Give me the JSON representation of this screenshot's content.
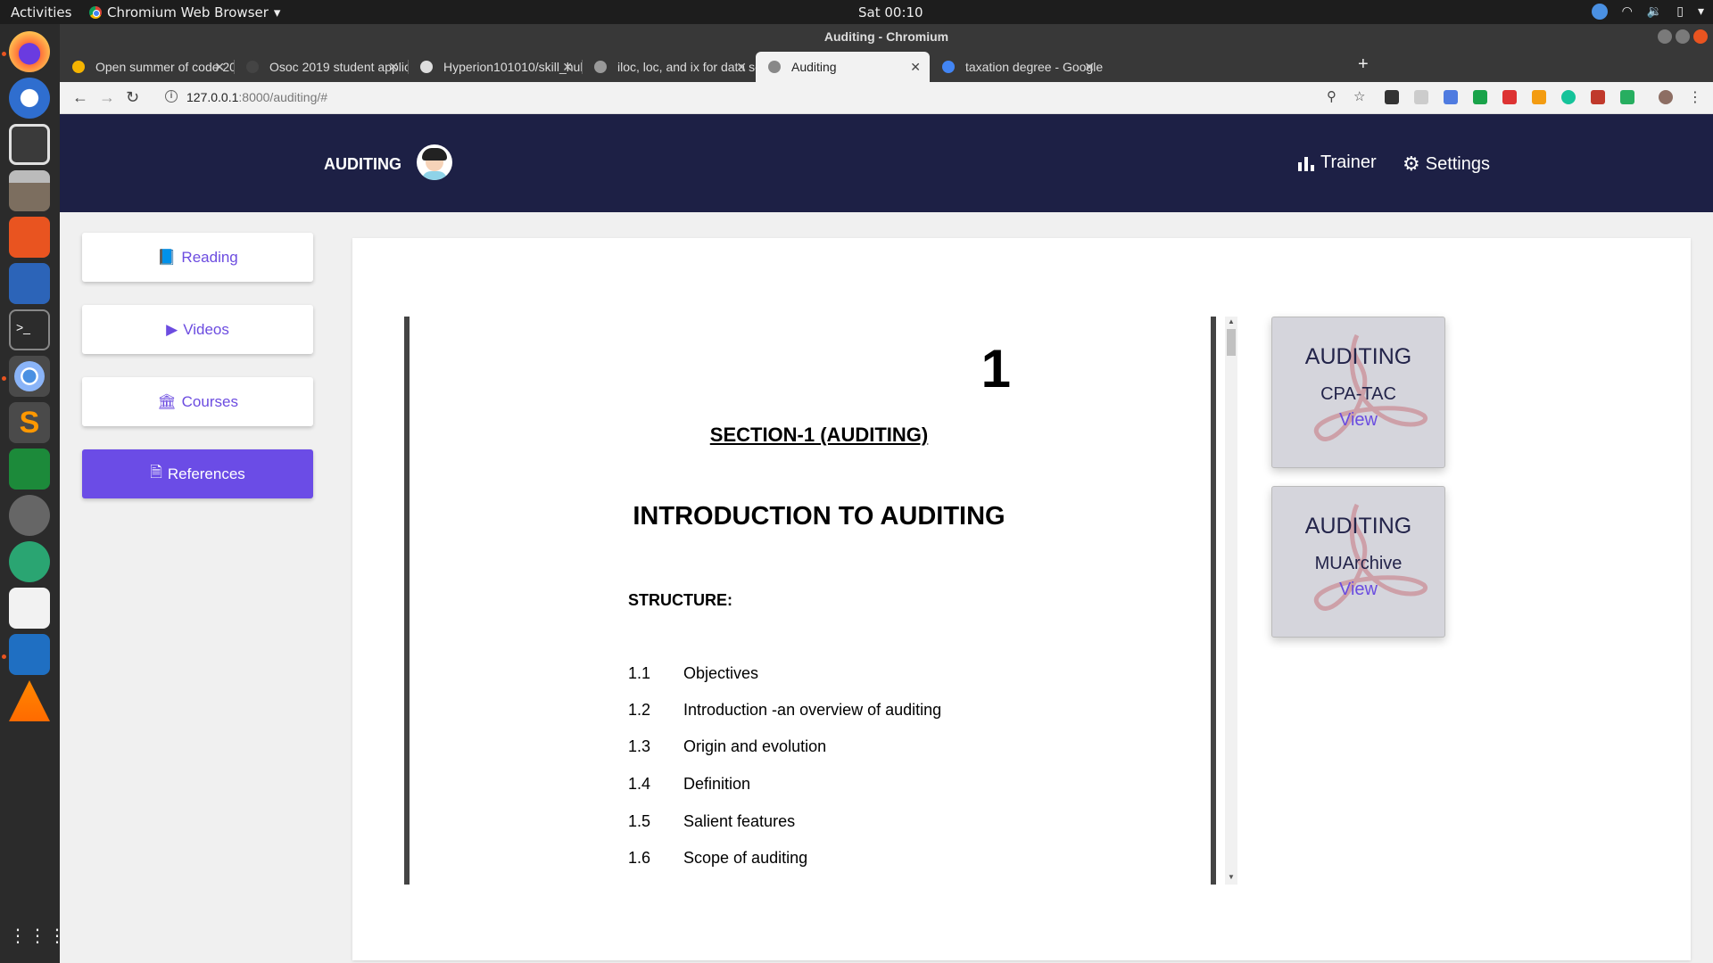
{
  "os": {
    "activities": "Activities",
    "app_menu": "Chromium Web Browser",
    "clock": "Sat 00:10",
    "dock_icons": [
      "firefox-icon",
      "thunderbird-icon",
      "rhythmbox-icon",
      "files-icon",
      "software-center-icon",
      "writer-icon",
      "terminal-icon",
      "chromium-icon",
      "sublime-icon",
      "calc-icon",
      "settings-icon",
      "atom-icon",
      "evince-icon",
      "vscode-icon",
      "vlc-icon",
      "app-grid-icon"
    ]
  },
  "browser": {
    "window_title": "Auditing - Chromium",
    "tabs": [
      {
        "title": "Open summer of code 20",
        "favicon_color": "#f5b400"
      },
      {
        "title": "Osoc 2019 student applic",
        "favicon_color": "#444444"
      },
      {
        "title": "Hyperion101010/skill_hul",
        "favicon_color": "#dddddd"
      },
      {
        "title": "iloc, loc, and ix for data se",
        "favicon_color": "#999999"
      },
      {
        "title": "Auditing",
        "favicon_color": "#888888",
        "active": true
      },
      {
        "title": "taxation degree - Google",
        "favicon_color": "#4285f4"
      }
    ],
    "url_host": "127.0.0.1",
    "url_rest": ":8000/auditing/#"
  },
  "app": {
    "brand": "AUDITING",
    "nav": {
      "trainer": "Trainer",
      "settings": "Settings"
    },
    "sidebar": [
      {
        "label": "Reading",
        "icon": "book-icon"
      },
      {
        "label": "Videos",
        "icon": "play-icon"
      },
      {
        "label": "Courses",
        "icon": "bank-icon"
      },
      {
        "label": "References",
        "icon": "file-icon",
        "active": true
      }
    ],
    "accent": "#6b4ce6",
    "navbar_color": "#1d2045"
  },
  "document": {
    "page_number": "1",
    "section": "SECTION-1 (AUDITING)",
    "heading": "INTRODUCTION TO AUDITING",
    "structure_label": "STRUCTURE:",
    "toc": [
      {
        "num": "1.1",
        "text": "Objectives"
      },
      {
        "num": "1.2",
        "text": "Introduction -an overview of auditing"
      },
      {
        "num": "1.3",
        "text": "Origin and evolution"
      },
      {
        "num": "1.4",
        "text": "Definition"
      },
      {
        "num": "1.5",
        "text": "Salient features"
      },
      {
        "num": "1.6",
        "text": "Scope of auditing"
      }
    ]
  },
  "references": [
    {
      "title": "AUDITING",
      "source": "CPA-TAC",
      "action": "View"
    },
    {
      "title": "AUDITING",
      "source": "MUArchive",
      "action": "View"
    }
  ]
}
